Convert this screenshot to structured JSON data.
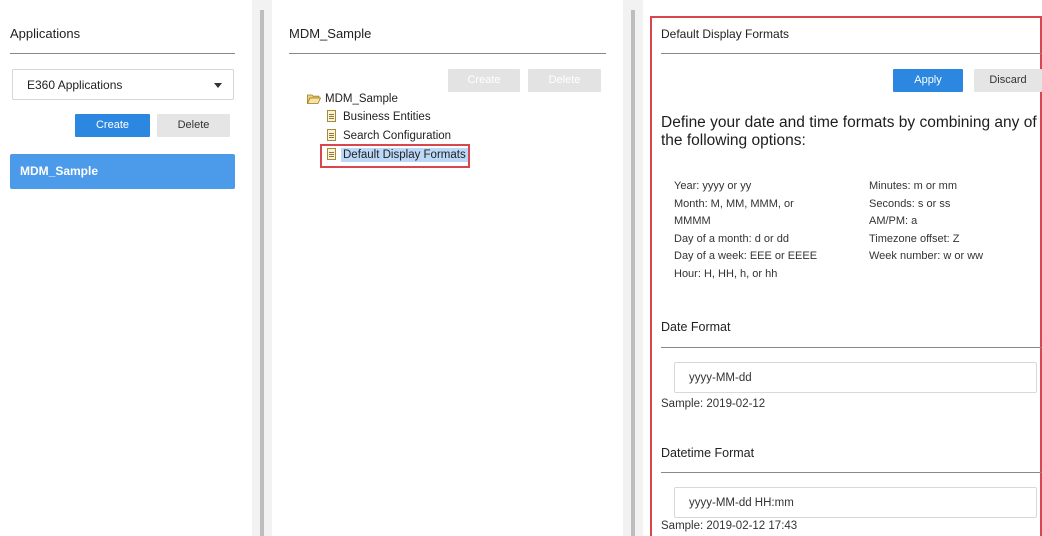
{
  "left_panel": {
    "title": "Applications",
    "select_value": "E360 Applications",
    "create_label": "Create",
    "delete_label": "Delete",
    "items": [
      {
        "label": "MDM_Sample"
      }
    ]
  },
  "middle_panel": {
    "title": "MDM_Sample",
    "create_label": "Create",
    "delete_label": "Delete",
    "tree": {
      "root": "MDM_Sample",
      "children": [
        {
          "label": "Business Entities"
        },
        {
          "label": "Search Configuration"
        },
        {
          "label": "Default Display Formats"
        }
      ]
    }
  },
  "right_panel": {
    "title": "Default Display Formats",
    "apply_label": "Apply",
    "discard_label": "Discard",
    "heading": "Define your date and time formats by combining any of the following options:",
    "options_left": [
      "Year: yyyy or yy",
      "Month: M, MM, MMM, or",
      "MMMM",
      "Day of a month: d or dd",
      "Day of a week: EEE or EEEE",
      "Hour: H, HH, h, or hh"
    ],
    "options_right": [
      "Minutes: m or mm",
      "Seconds: s or ss",
      "AM/PM: a",
      "Timezone offset: Z",
      "Week number: w or ww"
    ],
    "date_format": {
      "title": "Date Format",
      "value": "yyyy-MM-dd",
      "sample": "Sample:  2019-02-12"
    },
    "datetime_format": {
      "title": "Datetime Format",
      "value": "yyyy-MM-dd HH:mm",
      "sample": "Sample:  2019-02-12 17:43"
    }
  },
  "colors": {
    "primary": "#2b87e0",
    "selected_item": "#4c9aea",
    "highlight_border": "#d9464d",
    "selection_bg": "#bcd8f7"
  }
}
